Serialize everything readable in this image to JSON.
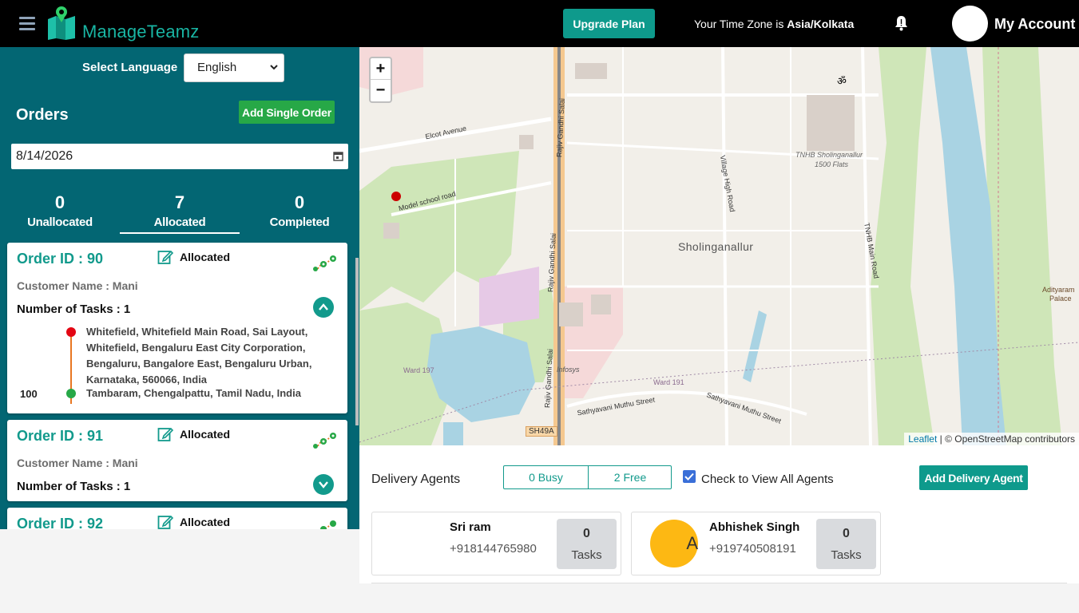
{
  "header": {
    "brand": "ManageTeamz",
    "upgrade_label": "Upgrade Plan",
    "timezone_prefix": "Your Time Zone is ",
    "timezone_value": "Asia/Kolkata",
    "account_label": "My Account",
    "icons": [
      "menu-icon",
      "logo-icon",
      "bell-icon"
    ]
  },
  "sidebar": {
    "language_label": "Select Language",
    "language_selected": "English",
    "orders_title": "Orders",
    "add_order_label": "Add Single Order",
    "date_value": "8/14/2026",
    "tabs": [
      {
        "count": "0",
        "label": "Unallocated"
      },
      {
        "count": "7",
        "label": "Allocated"
      },
      {
        "count": "0",
        "label": "Completed"
      }
    ],
    "orders": [
      {
        "id": "Order ID : 90",
        "status": "Allocated",
        "customer": "Customer Name : Mani",
        "tasks": "Number of Tasks : 1",
        "pickup": "Whitefield, Whitefield Main Road, Sai Layout, Whitefield, Bengaluru East City Corporation, Bengaluru, Bangalore East, Bengaluru Urban, Karnataka, 560066, India",
        "drop": "Tambaram, Chengalpattu, Tamil Nadu, India",
        "drop_num": "100"
      },
      {
        "id": "Order ID : 91",
        "status": "Allocated",
        "customer": "Customer Name : Mani",
        "tasks": "Number of Tasks : 1"
      },
      {
        "id": "Order ID : 92",
        "status": "Allocated"
      }
    ]
  },
  "map": {
    "zoom_in": "+",
    "zoom_out": "−",
    "labels": {
      "elcot": "Elcot Avenue",
      "model_school": "Model school road",
      "rajiv1": "Rajiv Gandhi Salai",
      "rajiv2": "Rajiv Gandhi Salai",
      "rajiv3": "Rajiv Gandhi Salai",
      "village": "Village High Road",
      "tnhb1": "TNHB Sholinganallur",
      "tnhb2": "1500 Flats",
      "tnhb_main": "TNHB Main Road",
      "sholinganallur": "Sholinganallur",
      "aditya1": "Adityaram",
      "aditya2": "Palace",
      "ward197": "Ward 197",
      "ward191": "Ward 191",
      "infosys": "Infosys",
      "sathya1": "Sathyavani Muthu Street",
      "sathya2": "Sathyavani Muthu Street",
      "sh49a": "SH49A",
      "om": "ॐ"
    },
    "attribution_link": "Leaflet",
    "attribution_text": " | © OpenStreetMap contributors"
  },
  "agents": {
    "title": "Delivery Agents",
    "busy_label": "0 Busy",
    "free_label": "2 Free",
    "view_all_label": "Check to View All Agents",
    "view_all_checked": true,
    "add_agent_label": "Add Delivery Agent",
    "list": [
      {
        "name": "Sri ram",
        "phone": "+918144765980",
        "task_count": "0",
        "task_label": "Tasks",
        "avatar_letter": ""
      },
      {
        "name": "Abhishek Singh",
        "phone": "+919740508191",
        "task_count": "0",
        "task_label": "Tasks",
        "avatar_letter": "A"
      }
    ]
  },
  "colors": {
    "teal": "#036673",
    "accent": "#129a8c",
    "green_btn": "#27a847",
    "avatar_yellow": "#fdb813"
  }
}
